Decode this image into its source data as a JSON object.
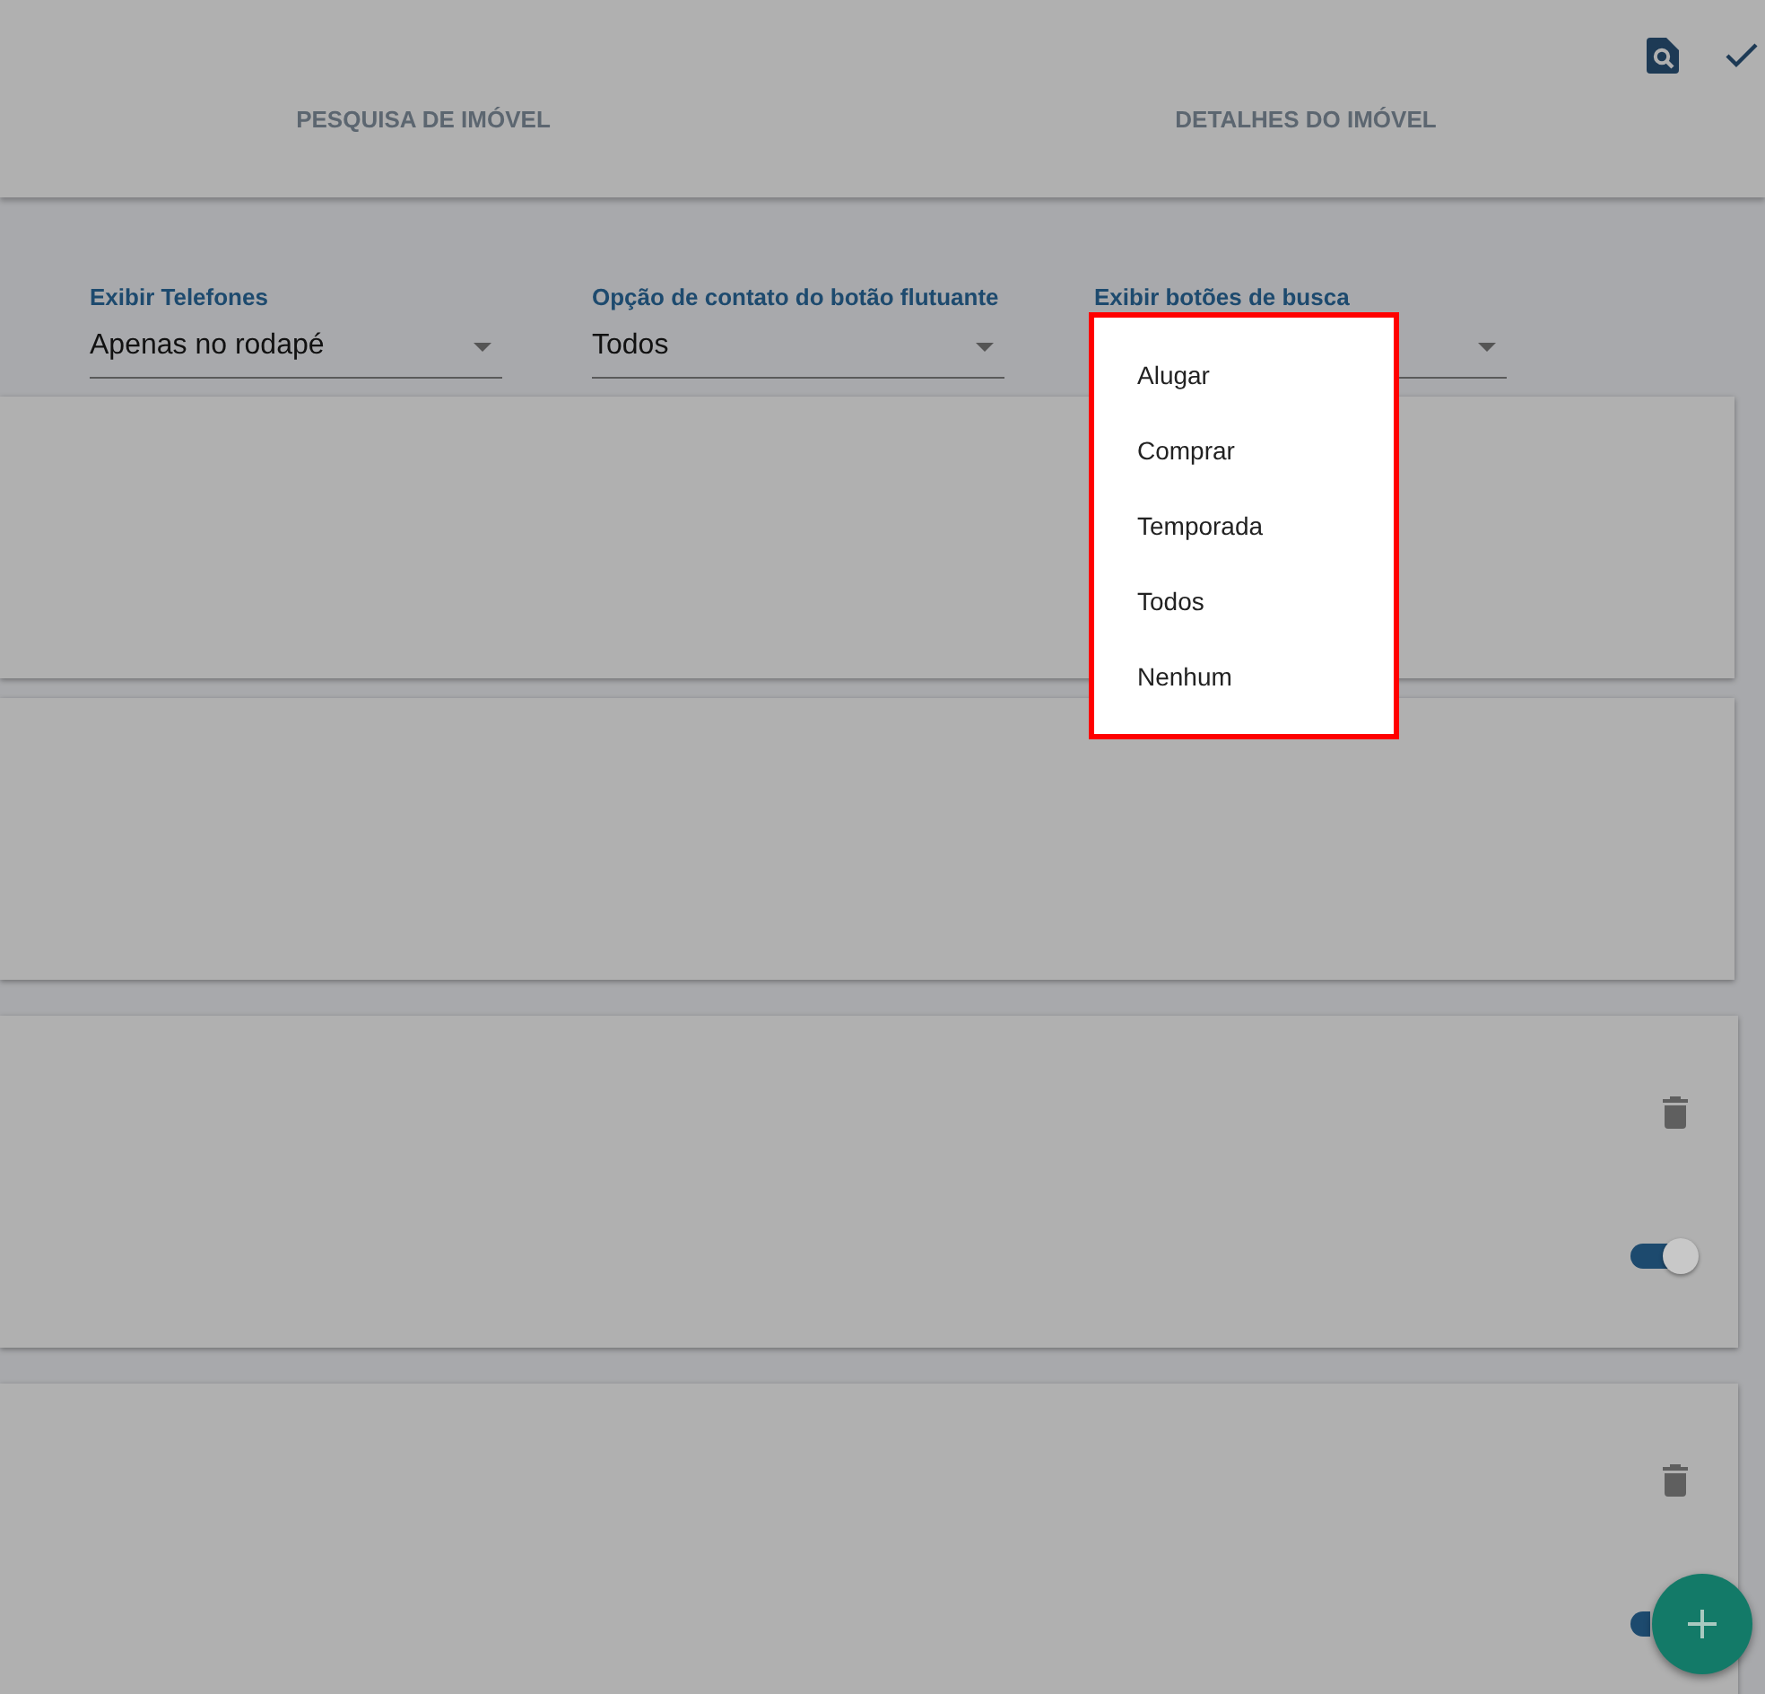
{
  "tabs": [
    {
      "label": "PESQUISA DE IMÓVEL"
    },
    {
      "label": "DETALHES DO IMÓVEL"
    }
  ],
  "selects": [
    {
      "label": "Exibir Telefones",
      "value": "Apenas no rodapé"
    },
    {
      "label": "Opção de contato do botão flutuante",
      "value": "Todos"
    },
    {
      "label": "Exibir botões de busca"
    }
  ],
  "cards": [
    {
      "kind": "empty"
    },
    {
      "kind": "empty"
    },
    {
      "kind": "item",
      "toggle_on": true
    },
    {
      "kind": "item",
      "toggle_on": true
    }
  ],
  "menu": {
    "items": [
      {
        "label": "Alugar"
      },
      {
        "label": "Comprar"
      },
      {
        "label": "Temporada"
      },
      {
        "label": "Todos"
      },
      {
        "label": "Nenhum"
      }
    ]
  }
}
